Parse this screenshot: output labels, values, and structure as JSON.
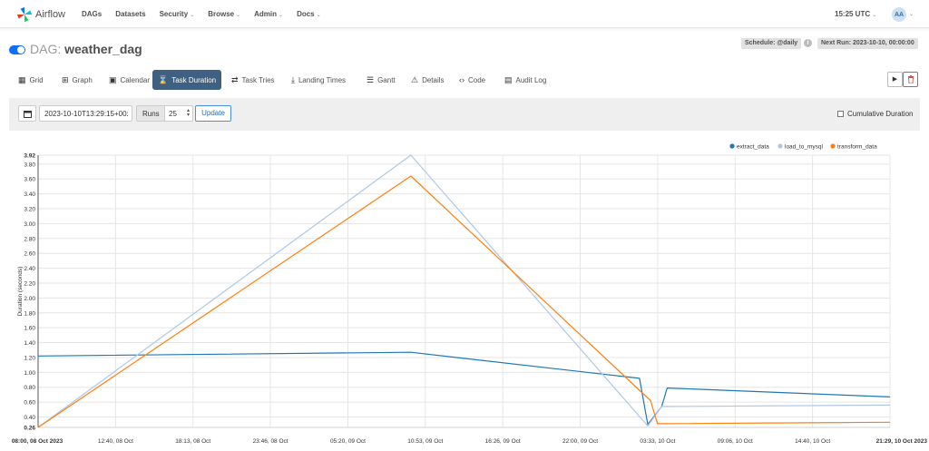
{
  "navbar": {
    "brand": "Airflow",
    "items": [
      {
        "label": "DAGs",
        "dropdown": false
      },
      {
        "label": "Datasets",
        "dropdown": false
      },
      {
        "label": "Security",
        "dropdown": true
      },
      {
        "label": "Browse",
        "dropdown": true
      },
      {
        "label": "Admin",
        "dropdown": true
      },
      {
        "label": "Docs",
        "dropdown": true
      }
    ],
    "time": "15:25 UTC",
    "user_initials": "AA",
    "brand_colors": [
      "#e43921",
      "#00ad46",
      "#04d659",
      "#0cb6ff",
      "#017cee",
      "#00c7d4"
    ]
  },
  "dag": {
    "prefix": "DAG:",
    "name": "weather_dag",
    "schedule": "Schedule: @daily",
    "next_run": "Next Run: 2023-10-10, 00:00:00",
    "toggle_on": true
  },
  "tabs": [
    {
      "label": "Grid",
      "icon": "grid-icon",
      "active": false
    },
    {
      "label": "Graph",
      "icon": "graph-icon",
      "active": false
    },
    {
      "label": "Calendar",
      "icon": "calendar-icon",
      "active": false
    },
    {
      "label": "Task Duration",
      "icon": "hourglass-icon",
      "active": true
    },
    {
      "label": "Task Tries",
      "icon": "retry-icon",
      "active": false
    },
    {
      "label": "Landing Times",
      "icon": "plane-landing-icon",
      "active": false
    },
    {
      "label": "Gantt",
      "icon": "gantt-icon",
      "active": false
    },
    {
      "label": "Details",
      "icon": "warning-icon",
      "active": false
    },
    {
      "label": "Code",
      "icon": "code-icon",
      "active": false
    },
    {
      "label": "Audit Log",
      "icon": "document-icon",
      "active": false
    }
  ],
  "filters": {
    "base_date": "2023-10-10T13:29:15+00:",
    "runs_label": "Runs",
    "runs_value": "25",
    "update_label": "Update",
    "cumulative_label": "Cumulative Duration",
    "cumulative_checked": false
  },
  "chart_data": {
    "type": "line",
    "ylabel": "Duration (seconds)",
    "xlabel": "",
    "ylim": [
      0.26,
      3.92
    ],
    "y_ticks": [
      "0.26",
      "0.40",
      "0.60",
      "0.80",
      "1.00",
      "1.20",
      "1.40",
      "1.60",
      "1.80",
      "2.00",
      "2.20",
      "2.40",
      "2.60",
      "2.80",
      "3.00",
      "3.20",
      "3.40",
      "3.60",
      "3.80",
      "3.92"
    ],
    "x_ticks": [
      "08:00, 08 Oct 2023",
      "12:40, 08 Oct",
      "18:13, 08 Oct",
      "23:46, 08 Oct",
      "05:20, 09 Oct",
      "10:53, 09 Oct",
      "16:26, 09 Oct",
      "22:00, 09 Oct",
      "03:33, 10 Oct",
      "09:06, 10 Oct",
      "14:40, 10 Oct",
      "21:29, 10 Oct 2023"
    ],
    "x_range_hours": [
      0,
      61.48
    ],
    "grid": true,
    "legend_position": "top-right",
    "series": [
      {
        "name": "extract_data",
        "color": "#1f77b4",
        "x": [
          0,
          26.9,
          43.4,
          44.0,
          45.0,
          45.4,
          61.48
        ],
        "y": [
          1.22,
          1.27,
          0.92,
          0.3,
          0.54,
          0.79,
          0.67
        ]
      },
      {
        "name": "load_to_mysql",
        "color": "#aec7e8",
        "x": [
          0,
          26.9,
          44.0,
          45.0,
          61.48
        ],
        "y": [
          0.26,
          3.92,
          0.28,
          0.54,
          0.56
        ]
      },
      {
        "name": "transform_data",
        "color": "#ff7f0e",
        "x": [
          0,
          26.9,
          44.2,
          44.7,
          45.0,
          61.48
        ],
        "y": [
          0.26,
          3.64,
          0.62,
          0.31,
          0.31,
          0.33
        ]
      }
    ]
  }
}
